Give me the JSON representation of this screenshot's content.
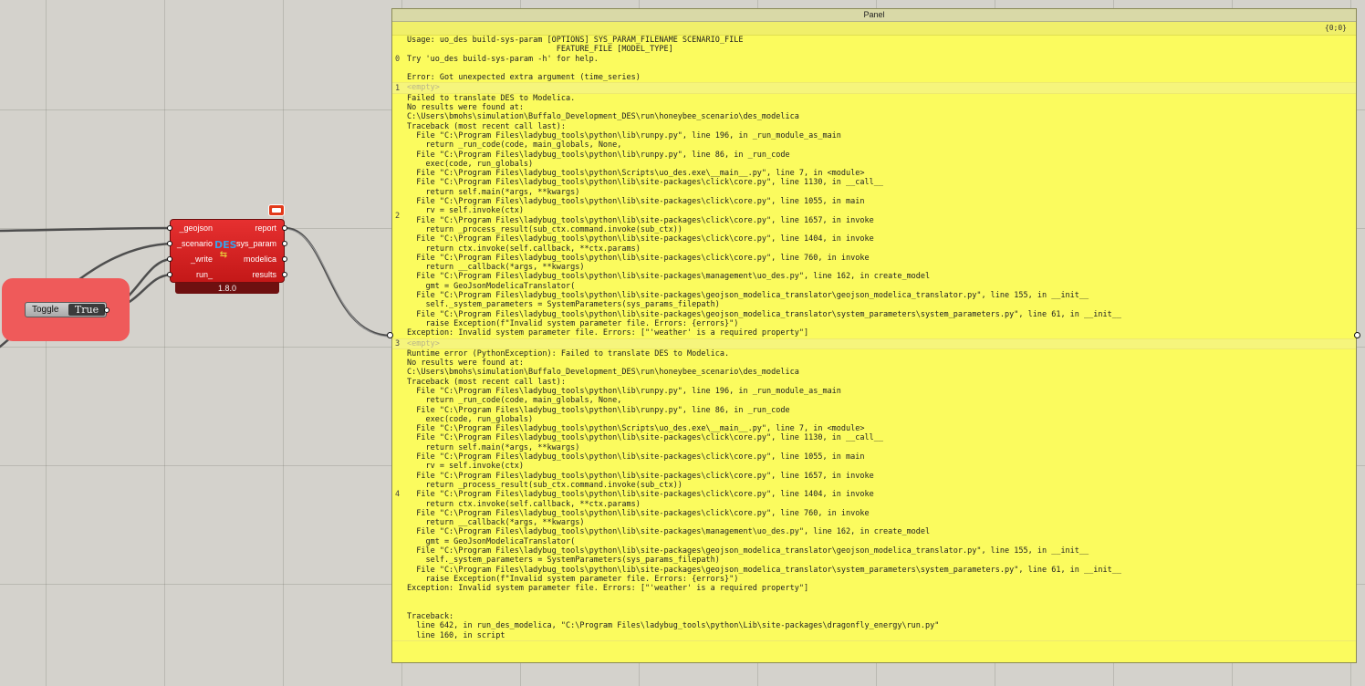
{
  "toggle": {
    "label": "Toggle",
    "value": "True"
  },
  "component": {
    "version": "1.8.0",
    "inputs": [
      "_geojson",
      "_scenario",
      "_write",
      "run_"
    ],
    "outputs": [
      "report",
      "sys_param",
      "modelica",
      "results"
    ],
    "icon_text": "DES"
  },
  "panel": {
    "title": "Panel",
    "path": "{0;0}",
    "branches": [
      {
        "index": "0",
        "text": "Usage: uo_des build-sys-param [OPTIONS] SYS_PARAM_FILENAME SCENARIO_FILE\n                                FEATURE_FILE [MODEL_TYPE]\nTry 'uo_des build-sys-param -h' for help.\n\nError: Got unexpected extra argument (time_series)"
      },
      {
        "index": "1",
        "text": "<empty>",
        "empty": true
      },
      {
        "index": "2",
        "text": "Failed to translate DES to Modelica.\nNo results were found at:\nC:\\Users\\bmohs\\simulation\\Buffalo_Development_DES\\run\\honeybee_scenario\\des_modelica\nTraceback (most recent call last):\n  File \"C:\\Program Files\\ladybug_tools\\python\\lib\\runpy.py\", line 196, in _run_module_as_main\n    return _run_code(code, main_globals, None,\n  File \"C:\\Program Files\\ladybug_tools\\python\\lib\\runpy.py\", line 86, in _run_code\n    exec(code, run_globals)\n  File \"C:\\Program Files\\ladybug_tools\\python\\Scripts\\uo_des.exe\\__main__.py\", line 7, in <module>\n  File \"C:\\Program Files\\ladybug_tools\\python\\lib\\site-packages\\click\\core.py\", line 1130, in __call__\n    return self.main(*args, **kwargs)\n  File \"C:\\Program Files\\ladybug_tools\\python\\lib\\site-packages\\click\\core.py\", line 1055, in main\n    rv = self.invoke(ctx)\n  File \"C:\\Program Files\\ladybug_tools\\python\\lib\\site-packages\\click\\core.py\", line 1657, in invoke\n    return _process_result(sub_ctx.command.invoke(sub_ctx))\n  File \"C:\\Program Files\\ladybug_tools\\python\\lib\\site-packages\\click\\core.py\", line 1404, in invoke\n    return ctx.invoke(self.callback, **ctx.params)\n  File \"C:\\Program Files\\ladybug_tools\\python\\lib\\site-packages\\click\\core.py\", line 760, in invoke\n    return __callback(*args, **kwargs)\n  File \"C:\\Program Files\\ladybug_tools\\python\\lib\\site-packages\\management\\uo_des.py\", line 162, in create_model\n    gmt = GeoJsonModelicaTranslator(\n  File \"C:\\Program Files\\ladybug_tools\\python\\lib\\site-packages\\geojson_modelica_translator\\geojson_modelica_translator.py\", line 155, in __init__\n    self._system_parameters = SystemParameters(sys_params_filepath)\n  File \"C:\\Program Files\\ladybug_tools\\python\\lib\\site-packages\\geojson_modelica_translator\\system_parameters\\system_parameters.py\", line 61, in __init__\n    raise Exception(f\"Invalid system parameter file. Errors: {errors}\")\nException: Invalid system parameter file. Errors: [\"'weather' is a required property\"]"
      },
      {
        "index": "3",
        "text": "<empty>",
        "empty": true
      },
      {
        "index": "4",
        "text": "Runtime error (PythonException): Failed to translate DES to Modelica.\nNo results were found at:\nC:\\Users\\bmohs\\simulation\\Buffalo_Development_DES\\run\\honeybee_scenario\\des_modelica\nTraceback (most recent call last):\n  File \"C:\\Program Files\\ladybug_tools\\python\\lib\\runpy.py\", line 196, in _run_module_as_main\n    return _run_code(code, main_globals, None,\n  File \"C:\\Program Files\\ladybug_tools\\python\\lib\\runpy.py\", line 86, in _run_code\n    exec(code, run_globals)\n  File \"C:\\Program Files\\ladybug_tools\\python\\Scripts\\uo_des.exe\\__main__.py\", line 7, in <module>\n  File \"C:\\Program Files\\ladybug_tools\\python\\lib\\site-packages\\click\\core.py\", line 1130, in __call__\n    return self.main(*args, **kwargs)\n  File \"C:\\Program Files\\ladybug_tools\\python\\lib\\site-packages\\click\\core.py\", line 1055, in main\n    rv = self.invoke(ctx)\n  File \"C:\\Program Files\\ladybug_tools\\python\\lib\\site-packages\\click\\core.py\", line 1657, in invoke\n    return _process_result(sub_ctx.command.invoke(sub_ctx))\n  File \"C:\\Program Files\\ladybug_tools\\python\\lib\\site-packages\\click\\core.py\", line 1404, in invoke\n    return ctx.invoke(self.callback, **ctx.params)\n  File \"C:\\Program Files\\ladybug_tools\\python\\lib\\site-packages\\click\\core.py\", line 760, in invoke\n    return __callback(*args, **kwargs)\n  File \"C:\\Program Files\\ladybug_tools\\python\\lib\\site-packages\\management\\uo_des.py\", line 162, in create_model\n    gmt = GeoJsonModelicaTranslator(\n  File \"C:\\Program Files\\ladybug_tools\\python\\lib\\site-packages\\geojson_modelica_translator\\geojson_modelica_translator.py\", line 155, in __init__\n    self._system_parameters = SystemParameters(sys_params_filepath)\n  File \"C:\\Program Files\\ladybug_tools\\python\\lib\\site-packages\\geojson_modelica_translator\\system_parameters\\system_parameters.py\", line 61, in __init__\n    raise Exception(f\"Invalid system parameter file. Errors: {errors}\")\nException: Invalid system parameter file. Errors: [\"'weather' is a required property\"]\n\n\nTraceback:\n  line 642, in run_des_modelica, \"C:\\Program Files\\ladybug_tools\\python\\Lib\\site-packages\\dragonfly_energy\\run.py\"\n  line 160, in script"
      }
    ]
  }
}
